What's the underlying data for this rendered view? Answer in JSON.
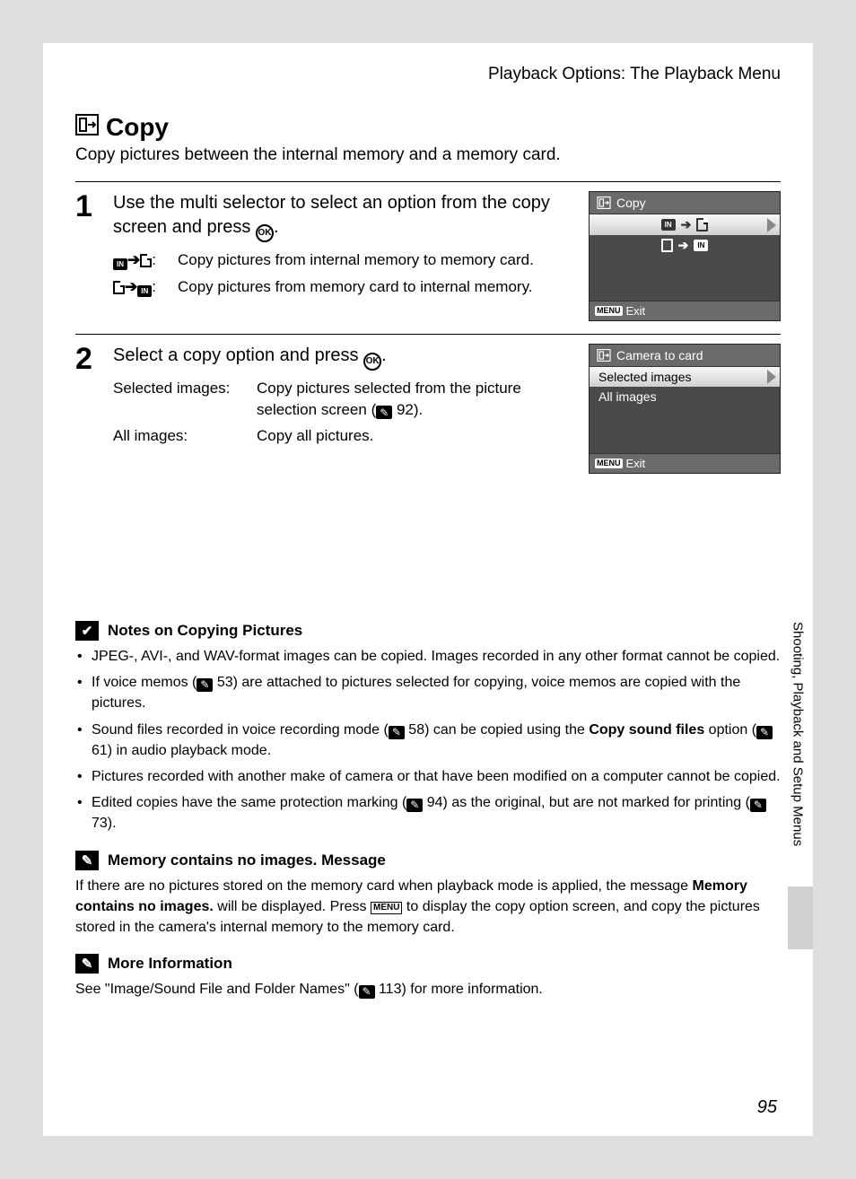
{
  "header": {
    "section": "Playback Options: The Playback Menu"
  },
  "title": "Copy",
  "intro": "Copy pictures between the internal memory and a memory card.",
  "step1": {
    "num": "1",
    "title_a": "Use the multi selector to select an option from the copy screen and press ",
    "title_b": ".",
    "opt_a": "Copy pictures from internal memory to memory card.",
    "opt_b": "Copy pictures from memory card to internal memory."
  },
  "step2": {
    "num": "2",
    "title_a": "Select a copy option and press ",
    "title_b": ".",
    "label_a": "Selected images:",
    "body_a1": "Copy pictures selected from the picture selection screen (",
    "ref_a": "92",
    "body_a2": ").",
    "label_b": "All images:",
    "body_b": "Copy all pictures."
  },
  "lcd1": {
    "title": "Copy",
    "exit": "Exit"
  },
  "lcd2": {
    "title": "Camera to card",
    "row1": "Selected images",
    "row2": "All images",
    "exit": "Exit"
  },
  "notes": {
    "head1": "Notes on Copying Pictures",
    "n1": "JPEG-, AVI-, and WAV-format images can be copied. Images recorded in any other format cannot be copied.",
    "n2a": "If voice memos (",
    "n2ref": "53",
    "n2b": ") are attached to pictures selected for copying, voice memos are copied with the pictures.",
    "n3a": "Sound files recorded in voice recording mode (",
    "n3ref1": "58",
    "n3b": ") can be copied using the ",
    "n3bold": "Copy sound files",
    "n3c": " option (",
    "n3ref2": "61",
    "n3d": ") in audio playback mode.",
    "n4": "Pictures recorded with another make of camera or that have been modified on a computer cannot be copied.",
    "n5a": "Edited copies have the same protection marking (",
    "n5ref1": "94",
    "n5b": ") as the original, but are not marked for printing (",
    "n5ref2": "73",
    "n5c": ")."
  },
  "msg": {
    "head_a": "Memory contains no images.",
    "head_b": " Message",
    "p1a": "If there are no pictures stored on the memory card when playback mode is applied, the message ",
    "p1bold": "Memory contains no images.",
    "p1b": " will be displayed. Press ",
    "p1c": " to display the copy option screen, and copy the pictures stored in the camera's internal memory to the memory card."
  },
  "more": {
    "head": "More Information",
    "p_a": "See \"Image/Sound File and Folder Names\" (",
    "ref": "113",
    "p_b": ") for more information."
  },
  "side": "Shooting, Playback and Setup Menus",
  "page": "95"
}
